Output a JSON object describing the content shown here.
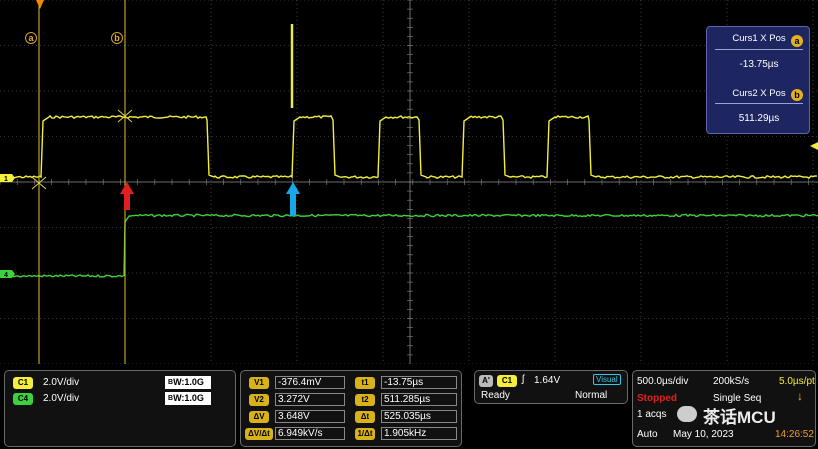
{
  "colors": {
    "ch1": "#f3ef3a",
    "ch4": "#3dd23d",
    "cursor": "#e0c030",
    "grid": "#6a6a6a",
    "marker_red": "#e02020",
    "marker_blue": "#18a8e8",
    "badge_gold": "#d8b21a"
  },
  "cursors": {
    "a_label": "a",
    "b_label": "b"
  },
  "cursor_readout": {
    "curs1_label": "Curs1 X Pos",
    "curs1_badge": "a",
    "curs1_value": "-13.75µs",
    "curs2_label": "Curs2 X Pos",
    "curs2_badge": "b",
    "curs2_value": "511.29µs"
  },
  "channels": [
    {
      "badge": "C1",
      "scale": "2.0V/div",
      "bw_prefix": "B",
      "bw": "W:1.0G",
      "color": "#f3ef3a"
    },
    {
      "badge": "C4",
      "scale": "2.0V/div",
      "bw_prefix": "B",
      "bw": "W:1.0G",
      "color": "#3dd23d"
    }
  ],
  "measurements": {
    "v1_label": "V1",
    "v1": "-376.4mV",
    "v2_label": "V2",
    "v2": "3.272V",
    "dv_label": "ΔV",
    "dv": "3.648V",
    "dvdt_label": "ΔV/Δt",
    "dvdt": "6.949kV/s",
    "t1_label": "t1",
    "t1": "-13.75µs",
    "t2_label": "t2",
    "t2": "511.285µs",
    "dt_label": "Δt",
    "dt": "525.035µs",
    "inv_label": "1/Δt",
    "inv": "1.905kHz"
  },
  "trigger": {
    "mode_badge": "A'",
    "source": "C1",
    "slope_glyph": "ʃ",
    "level": "1.64V",
    "visual": "Visual",
    "state": "Ready",
    "type": "Normal"
  },
  "acquisition": {
    "timebase": "500.0µs/div",
    "sample_rate": "200kS/s",
    "resolution": "5.0µs/pt",
    "status": "Stopped",
    "mode": "Single Seq",
    "acqs": "1 acqs",
    "trigger_mode": "Auto",
    "date": "May 10, 2023",
    "time": "14:26:52"
  },
  "watermark": {
    "text": "茶话MCU"
  }
}
